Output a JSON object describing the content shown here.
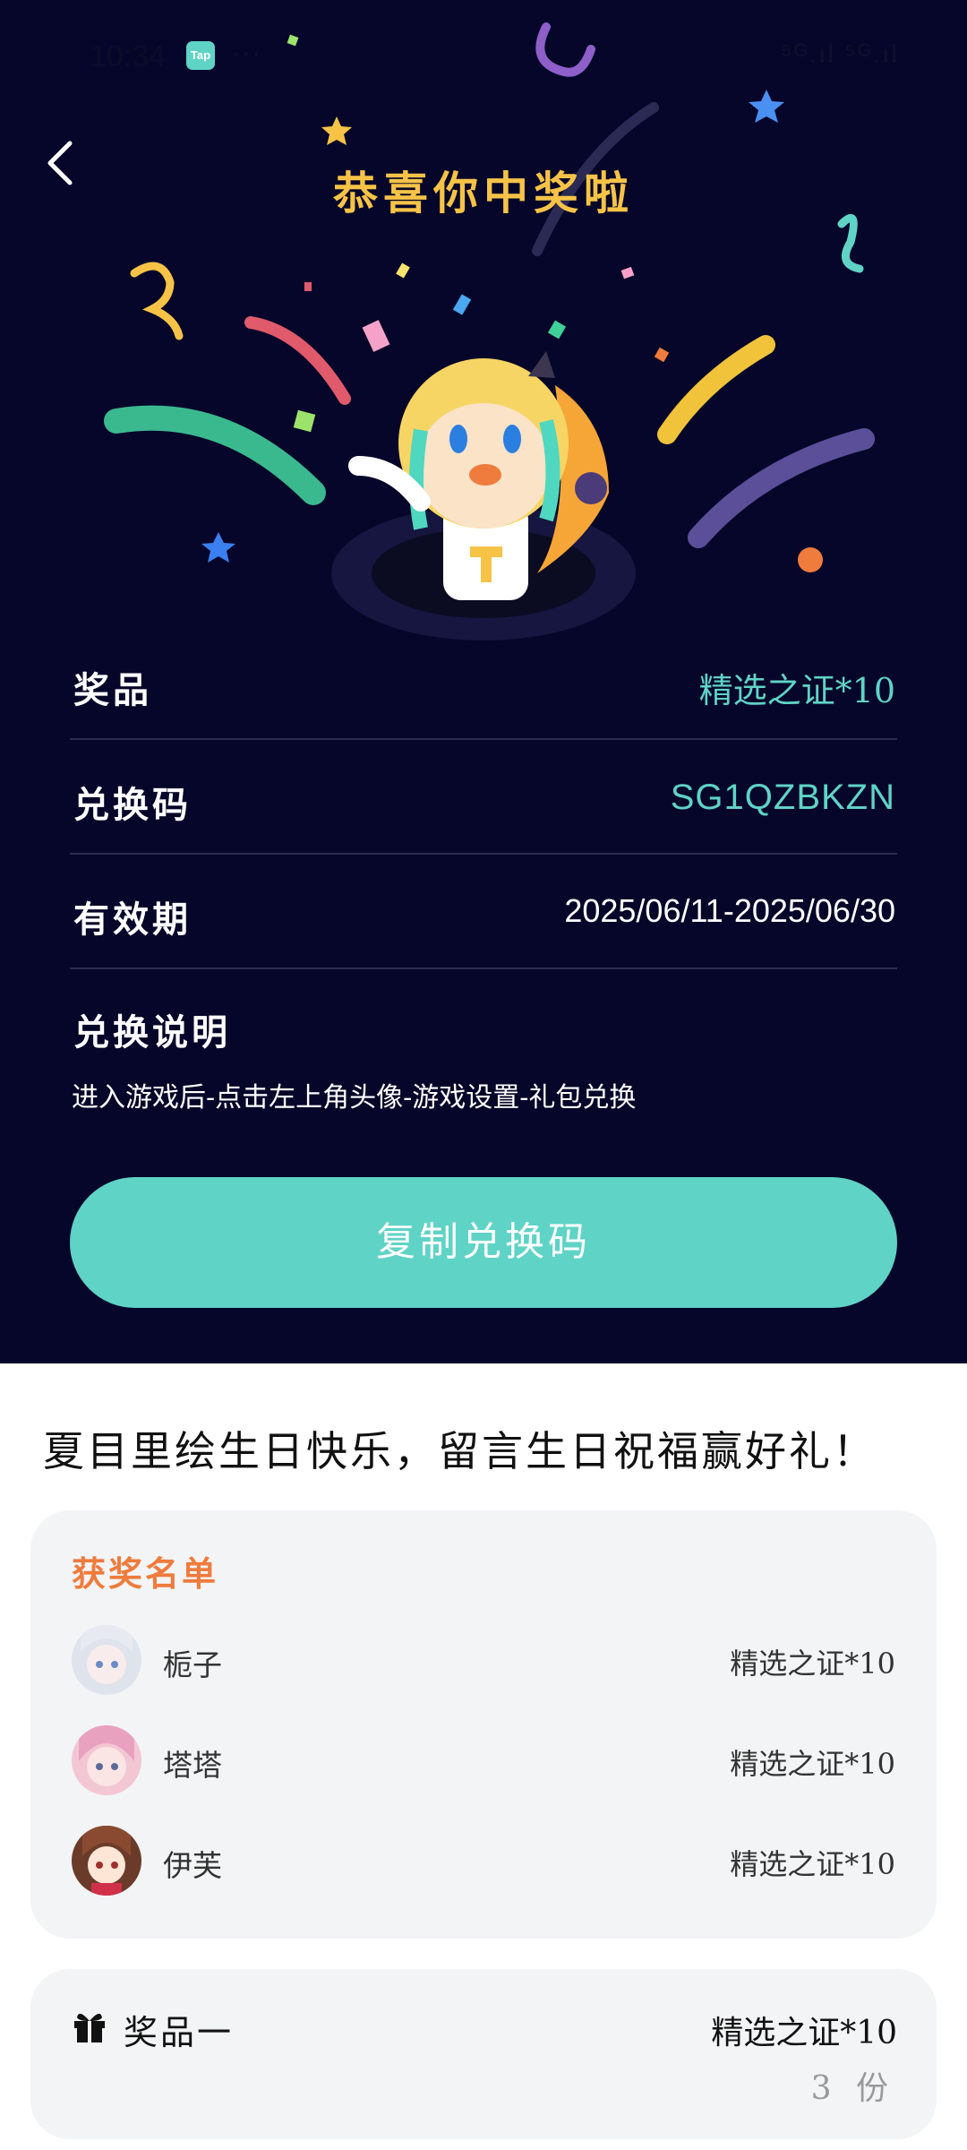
{
  "status_bar": {
    "time": "10:34",
    "tap_badge": "Tap",
    "more": "···",
    "signals": "⁵ᴳ.ıl ⁵ᴳ.ıl"
  },
  "header": {
    "title": "恭喜你中奖啦"
  },
  "details": [
    {
      "key": "奖品",
      "value": "精选之证*10"
    },
    {
      "key": "兑换码",
      "value": "SG1QZBKZN"
    },
    {
      "key": "有效期",
      "value": "2025/06/11-2025/06/30"
    }
  ],
  "instructions": {
    "title": "兑换说明",
    "text": "进入游戏后-点击左上角头像-游戏设置-礼包兑换"
  },
  "copy_button": "复制兑换码",
  "event": {
    "headline": "夏目里绘生日快乐，留言生日祝福赢好礼！"
  },
  "winners": {
    "title": "获奖名单",
    "items": [
      {
        "name": "栀子",
        "prize": "精选之证*10"
      },
      {
        "name": "塔塔",
        "prize": "精选之证*10"
      },
      {
        "name": "伊芙",
        "prize": "精选之证*10"
      }
    ]
  },
  "prize_tier": {
    "name": "奖品一",
    "value": "精选之证*10",
    "count": "3 份"
  },
  "colors": {
    "bg_dark": "#06062a",
    "accent": "#5fd3c6",
    "title_gold": "#f7c347",
    "winners_title": "#ef7b3c"
  }
}
